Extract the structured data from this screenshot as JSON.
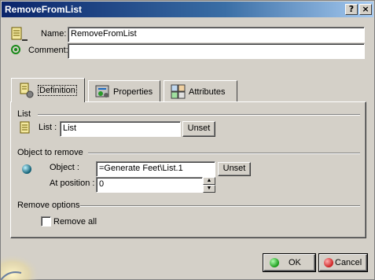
{
  "window": {
    "title": "RemoveFromList",
    "help_glyph": "?",
    "close_glyph": "×"
  },
  "header": {
    "name_label": "Name:",
    "name_value": "RemoveFromList",
    "comment_label": "Comment:",
    "comment_value": ""
  },
  "tabs": [
    {
      "label": "Definition",
      "icon": "definition-icon",
      "active": true
    },
    {
      "label": "Properties",
      "icon": "properties-icon",
      "active": false
    },
    {
      "label": "Attributes",
      "icon": "attributes-icon",
      "active": false
    }
  ],
  "definition": {
    "list_group": "List",
    "list_label": "List :",
    "list_value": "List",
    "list_unset": "Unset",
    "object_group": "Object to remove",
    "object_label": "Object :",
    "object_value": "=Generate Feet\\List.1",
    "object_unset": "Unset",
    "position_label": "At position :",
    "position_value": "0",
    "options_group": "Remove options",
    "remove_all_label": "Remove all",
    "remove_all_checked": false
  },
  "footer": {
    "ok_label": "OK",
    "cancel_label": "Cancel"
  },
  "colors": {
    "title_start": "#0a246a",
    "title_end": "#a6caf0",
    "ok_dot": "#1a9a1a",
    "cancel_dot": "#cc2020",
    "sphere": "#1a7fa0"
  }
}
